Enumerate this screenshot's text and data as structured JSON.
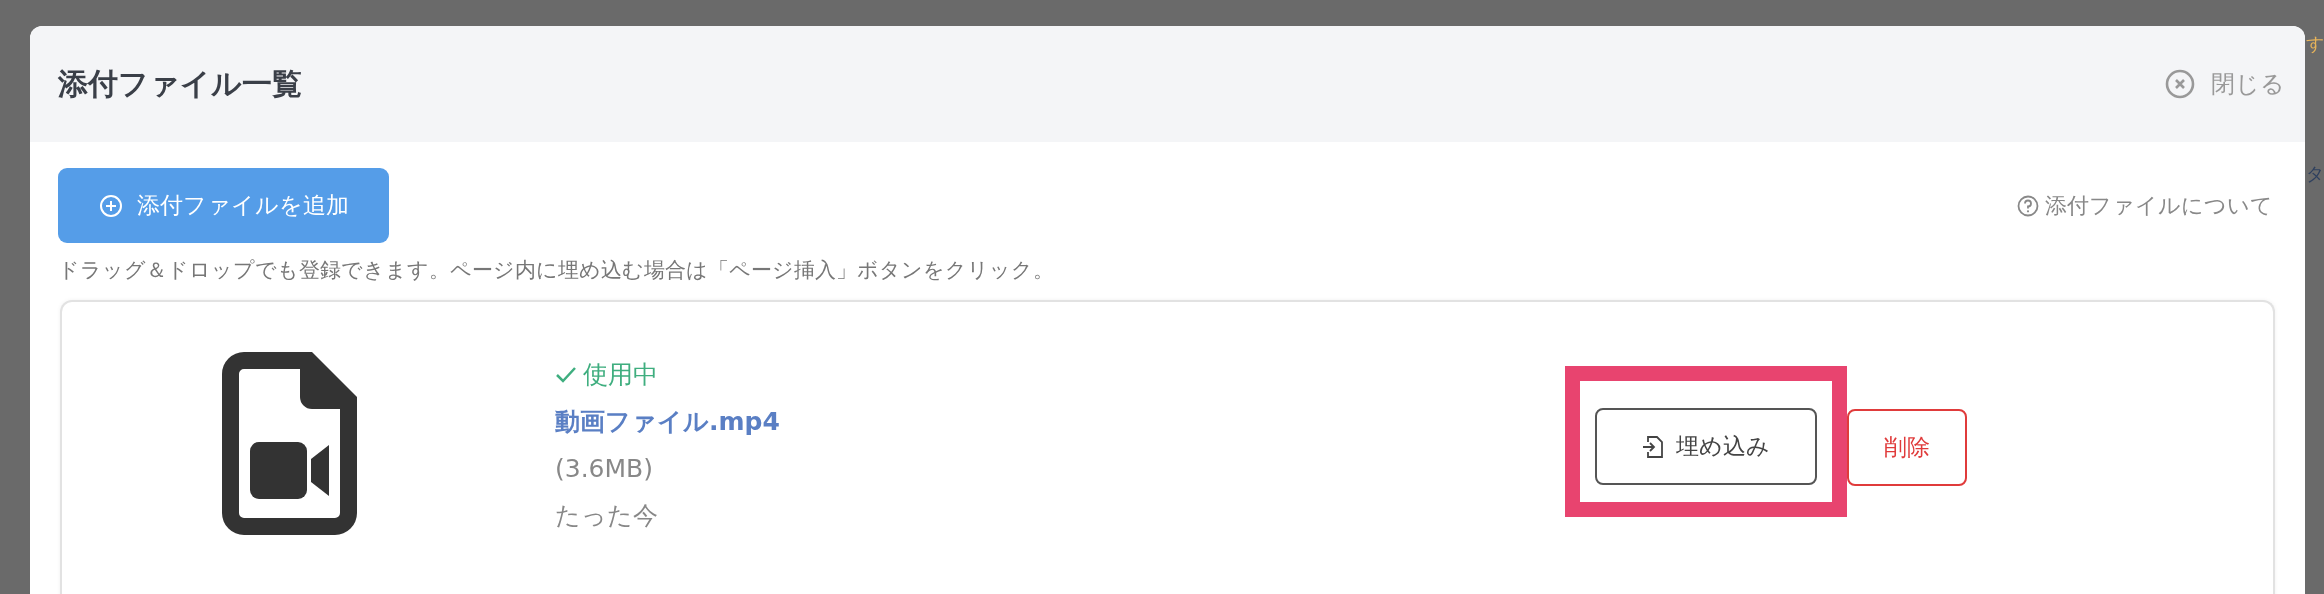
{
  "background": {
    "texts": [
      "す",
      "タ"
    ]
  },
  "dialog": {
    "title": "添付ファイル一覧",
    "close_label": "閉じる",
    "add_button": "添付ファイルを追加",
    "help_link": "添付ファイルについて",
    "hint": "ドラッグ＆ドロップでも登録できます。ページ内に埋め込む場合は「ページ挿入」ボタンをクリック。",
    "files": [
      {
        "kind": "video",
        "in_use": true,
        "status": "使用中",
        "name": "動画ファイル.mp4",
        "size": "(3.6MB)",
        "time": "たった今",
        "actions": [
          {
            "kind": "embed",
            "label": "埋め込み",
            "highlighted": true
          },
          {
            "kind": "delete",
            "label": "削除",
            "highlighted": false
          }
        ]
      }
    ]
  }
}
